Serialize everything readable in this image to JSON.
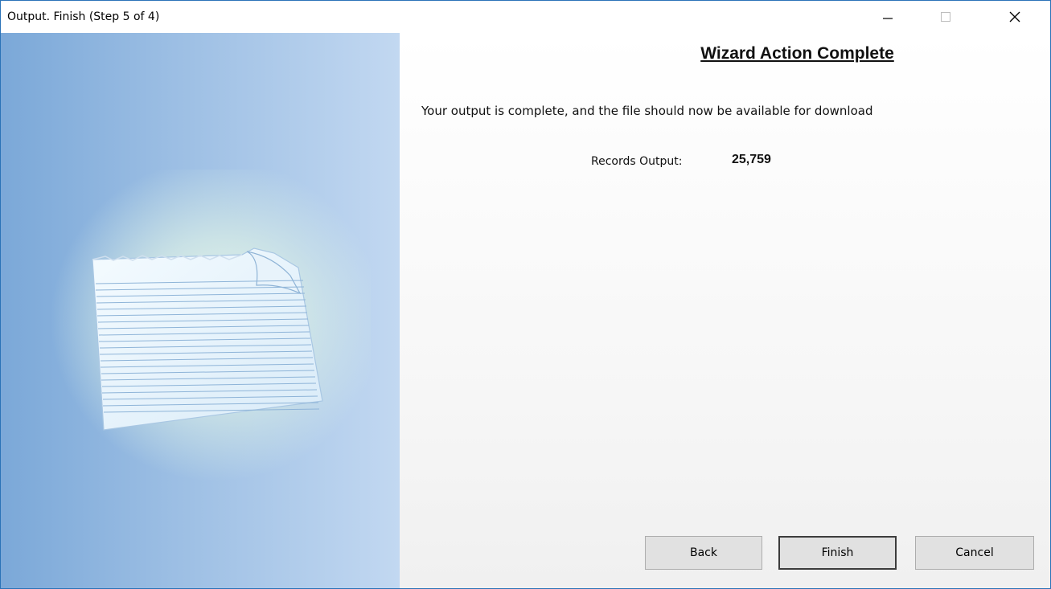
{
  "window": {
    "title": "Output.  Finish (Step 5 of 4)"
  },
  "wizard": {
    "heading": "Wizard Action Complete",
    "message": "Your output is complete, and the file should now be available for download",
    "records_label": "Records Output:",
    "records_value": "25,759"
  },
  "buttons": {
    "back": "Back",
    "finish": "Finish",
    "cancel": "Cancel"
  },
  "icons": {
    "minimize": "minimize-icon",
    "maximize": "maximize-icon",
    "close": "close-icon",
    "document": "document-page-icon"
  },
  "colors": {
    "side_panel_light": "#c2d8f1",
    "side_panel_dark": "#7ba8d8",
    "button_face": "#e1e1e1"
  }
}
